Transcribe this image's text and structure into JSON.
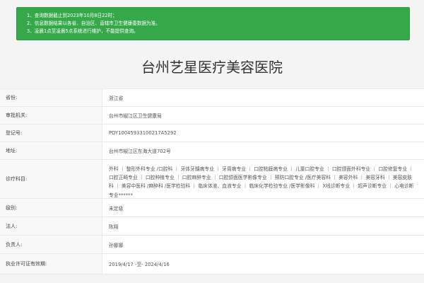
{
  "notice": {
    "lines": [
      "1、查询数据截止到2023年10月8日22时；",
      "2、信息数据结果以各省、自治区、直辖市卫生健康委数据为准。",
      "3、凌晨1点至凌晨5点系统进行维护，不能提供查询。"
    ]
  },
  "page_title": "台州艺星医疗美容医院",
  "rows": [
    {
      "label": "省份:",
      "value": "浙江省"
    },
    {
      "label": "审批机关:",
      "value": "台州市椒江区卫生健康局"
    },
    {
      "label": "登记号:",
      "value": "PDY10045933100217A5292"
    },
    {
      "label": "地址:",
      "value": "台州市椒江区东海大道702号"
    },
    {
      "label": "诊疗科目:",
      "value": "外科 ｜ 整形外科专业 /口腔科 ｜ 牙体牙髓病专业 ｜ 牙周病专业 ｜ 口腔粘膜病专业 ｜ 儿童口腔专业 ｜ 口腔颌面外科专业 ｜ 口腔修复专业 ｜ 口腔正畸专业 ｜ 口腔种植专业 ｜ 口腔麻醉专业 ｜ 口腔颌面医学影像专业 ｜ 预防口腔专业 /医疗美容科 ｜ 美容外科 ｜ 美容牙科 ｜ 美容皮肤科 ｜ 美容中医科 /麻醉科 /医学检验科 ｜ 临床体液、血液专业 ｜ 临床化学检验专业 /医学影像科 ｜ X线诊断专业 ｜ 超声诊断专业 ｜ 心电诊断专业******"
    },
    {
      "label": "级别:",
      "value": "未定级"
    },
    {
      "label": "法人:",
      "value": "陈翔"
    },
    {
      "label": "负责人:",
      "value": "孙娜娜"
    },
    {
      "label": "执业许可证有效期:",
      "value": "2019/4/17 -至- 2024/4/16"
    }
  ]
}
